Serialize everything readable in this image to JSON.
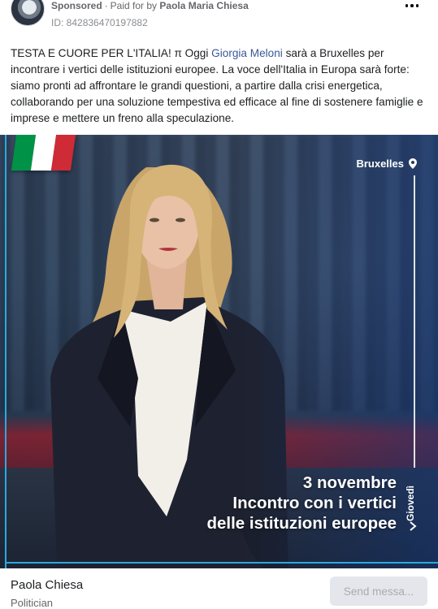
{
  "header": {
    "sponsored_label": "Sponsored",
    "paid_for_prefix": "Paid for by",
    "paid_for_name": "Paola Maria Chiesa",
    "id_text": "ID: 842836470197882",
    "more_icon": "more-horizontal-icon"
  },
  "post": {
    "text_before_link": "TESTA E CUORE PER L'ITALIA! π Oggi ",
    "link_text": "Giorgia Meloni",
    "text_after_link": " sarà a Bruxelles per incontrare i vertici delle istituzioni europee. La voce dell'Italia in Europa sarà forte: siamo pronti ad affrontare le grandi questioni, a partire dalla crisi energetica, collaborando per una soluzione tempestiva ed efficace al fine di sostenere famiglie e imprese e mettere un freno alla speculazione."
  },
  "image": {
    "location": "Bruxelles",
    "day": "Giovedì",
    "headline_line1": "3 novembre",
    "headline_line2": "Incontro con i vertici",
    "headline_line3": "delle istituzioni europee",
    "flag_colors": [
      "#009246",
      "#ffffff",
      "#ce2b37"
    ],
    "accent_color": "#2aa9e0"
  },
  "footer": {
    "advertiser_name": "Paola Chiesa",
    "advertiser_role": "Politician",
    "send_button_label": "Send messa..."
  },
  "colors": {
    "link": "#385898",
    "muted": "#65676b",
    "button_bg": "#e4e6eb"
  }
}
